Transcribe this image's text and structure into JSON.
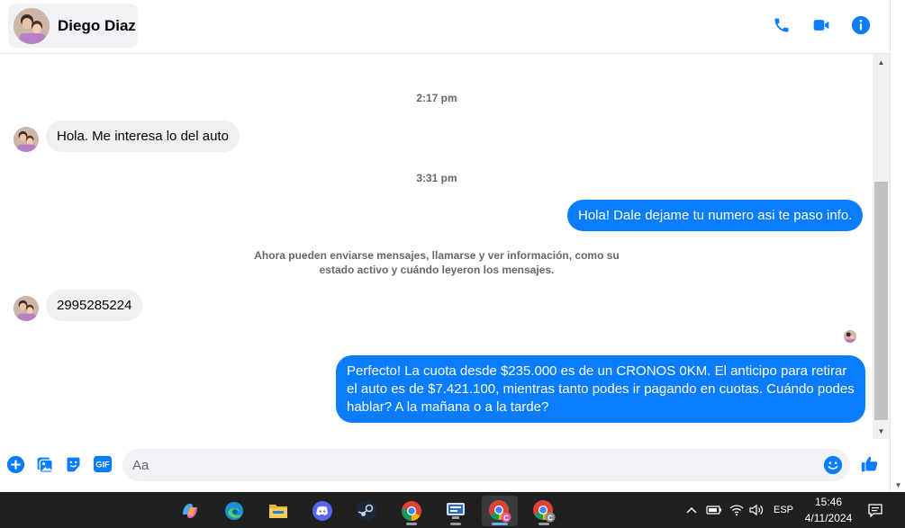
{
  "header": {
    "contact_name": "Diego Diaz",
    "icons": [
      "phone-icon",
      "video-call-icon",
      "info-icon"
    ]
  },
  "colors": {
    "accent": "#0a7cff",
    "incoming_bubble": "#f0f0f0",
    "taskbar": "#202020"
  },
  "conversation": {
    "timestamp_1": "2:17 pm",
    "msg_1": "Hola. Me interesa lo del auto",
    "timestamp_2": "3:31 pm",
    "msg_2": "Hola! Dale dejame tu numero  asi te paso info.",
    "system_note": "Ahora pueden enviarse mensajes, llamarse y ver información, como su estado activo y cuándo leyeron los mensajes.",
    "msg_3": "2995285224",
    "msg_4": "Perfecto! La cuota desde $235.000 es de un CRONOS 0KM. El anticipo para retirar el auto es de $7.421.100, mientras tanto podes ir pagando en cuotas. Cuándo podes hablar? A la mañana o a la tarde?"
  },
  "composer": {
    "placeholder": "Aa",
    "gif_label": "GIF"
  },
  "taskbar": {
    "apps": [
      "copilot-icon",
      "edge-icon",
      "file-explorer-icon",
      "discord-icon",
      "steam-icon",
      "chrome-icon",
      "network-app-icon",
      "chrome-profile-c-icon",
      "chrome-profile-c-icon-2"
    ],
    "language": "ESP",
    "time": "15:46",
    "date": "4/11/2024"
  }
}
